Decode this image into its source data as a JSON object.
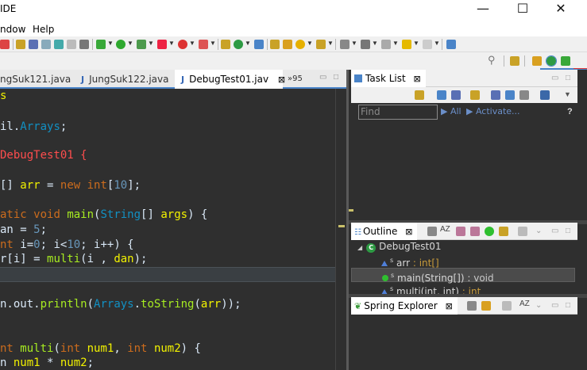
{
  "window": {
    "title": "IDE",
    "minimize": "—",
    "maximize": "☐",
    "close": "✕"
  },
  "menu": {
    "items": [
      "ndow",
      "Help"
    ]
  },
  "editor": {
    "tabs": [
      {
        "label": "ngSuk121.java",
        "active": false
      },
      {
        "label": "JungSuk122.java",
        "active": false
      },
      {
        "label": "DebugTest01.jav",
        "active": true,
        "close": "⊠"
      },
      {
        "label": "»95",
        "active": false
      }
    ],
    "code_lines": [
      "",
      "il.Arrays;",
      "",
      "DebugTest01 {",
      "",
      "[] arr = new int[10];",
      "",
      "atic void main(String[] args) {",
      "an = 5;",
      "nt i=0; i<10; i++) {",
      "r[i] = multi(i , dan);",
      "",
      "",
      "n.out.println(Arrays.toString(arr));",
      "",
      "",
      "nt multi(int num1, int num2) {",
      "n num1 * num2;"
    ]
  },
  "task_list": {
    "title": "Task List",
    "close": "⊠",
    "find_placeholder": "Find",
    "all_label": "All",
    "activate_label": "Activate...",
    "help": "?"
  },
  "outline": {
    "title": "Outline",
    "close": "⊠",
    "class_name": "DebugTest01",
    "items": [
      {
        "name": "arr",
        "type": ": int[]",
        "superscript": "s"
      },
      {
        "name": "main(String[])",
        "type": ": void",
        "superscript": "s"
      },
      {
        "name": "multi(int, int)",
        "type": ": int",
        "superscript": "s"
      }
    ]
  },
  "spring_explorer": {
    "title": "Spring Explorer",
    "close": "⊠"
  },
  "colors": {
    "editor_bg": "#2f2f2f",
    "keyword": "#cc6c1d",
    "class": "#ff4d4d",
    "accent": "#4a84c8",
    "highlight_row": "#3a3f43"
  },
  "icons": [
    "search-icon",
    "perspective-icon",
    "debug-icon",
    "spring-icon",
    "java-icon"
  ]
}
